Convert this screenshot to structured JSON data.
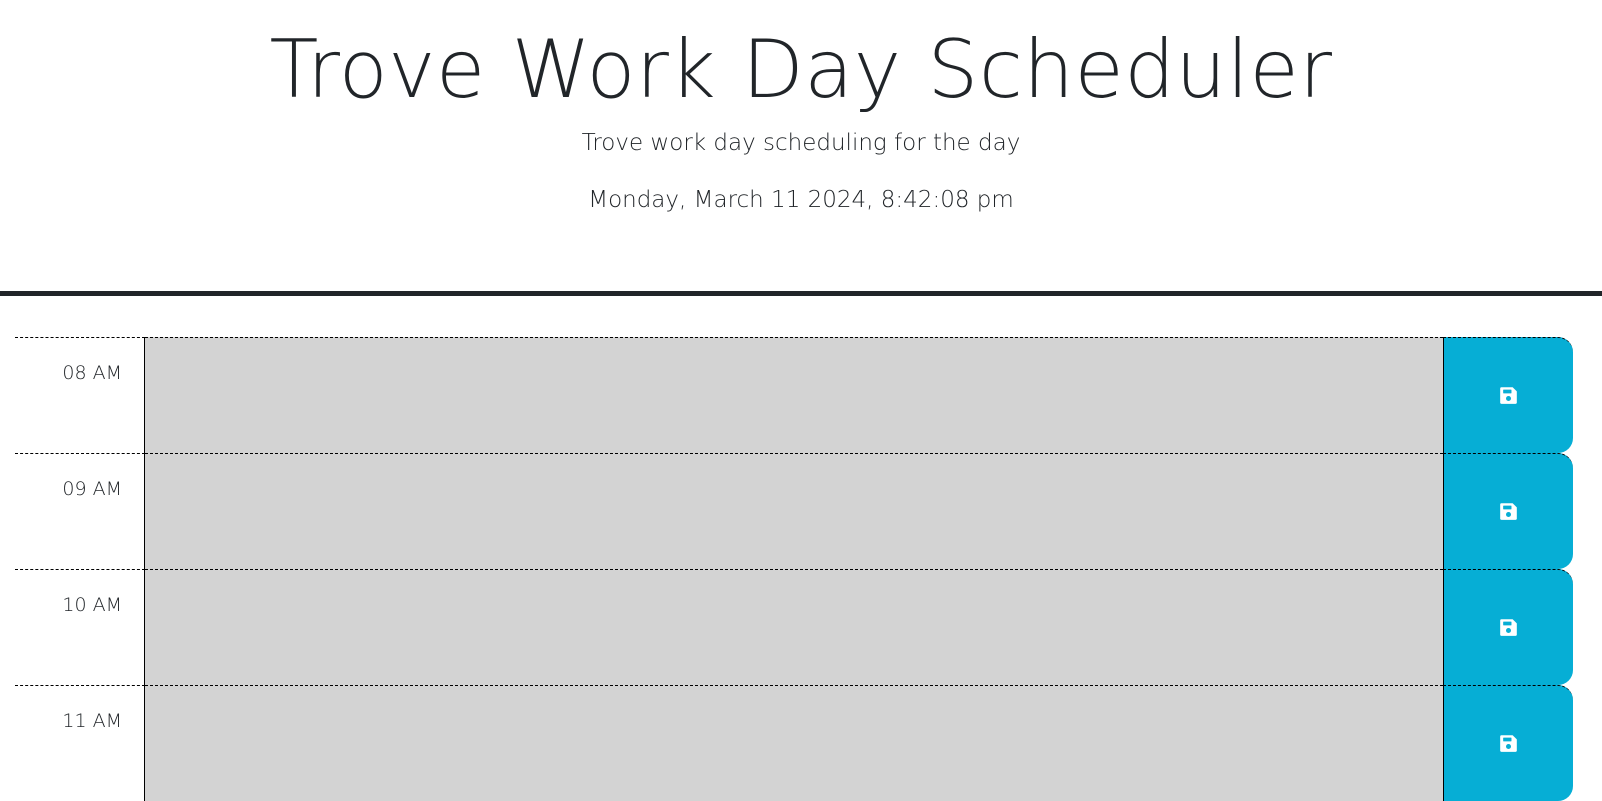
{
  "header": {
    "title": "Trove Work Day Scheduler",
    "subtitle": "Trove work day scheduling for the day",
    "current_datetime": "Monday, March 11 2024, 8:42:08 pm"
  },
  "time_blocks": [
    {
      "hour": "08 AM",
      "description": "",
      "save_icon": "save-icon"
    },
    {
      "hour": "09 AM",
      "description": "",
      "save_icon": "save-icon"
    },
    {
      "hour": "10 AM",
      "description": "",
      "save_icon": "save-icon"
    },
    {
      "hour": "11 AM",
      "description": "",
      "save_icon": "save-icon"
    }
  ],
  "colors": {
    "past_block": "#d3d3d3",
    "save_button": "#06aed5",
    "header_border": "#212529"
  }
}
